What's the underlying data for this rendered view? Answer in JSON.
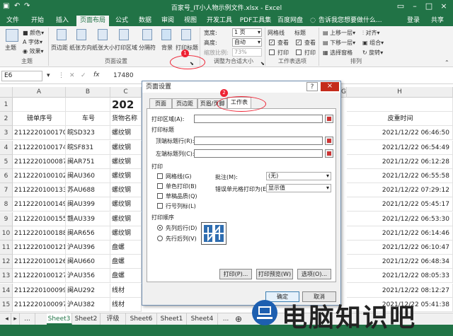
{
  "title": "百家号_IT小人物示例文件.xlsx - Excel",
  "tabs": [
    "文件",
    "开始",
    "插入",
    "页面布局",
    "公式",
    "数据",
    "审阅",
    "视图",
    "开发工具",
    "PDF工具集",
    "百度网盘"
  ],
  "active_tab": "页面布局",
  "tell_me": "告诉我您想要做什么...",
  "login": "登录",
  "share": "共享",
  "ribbon": {
    "theme": {
      "label": "主题",
      "colors": "颜色",
      "fonts": "字体",
      "effects": "效果",
      "group": "主题"
    },
    "margins": "页边距",
    "orientation": "纸张方向",
    "size": "纸张大小",
    "print_area": "打印区域",
    "breaks": "分隔符",
    "background": "背景",
    "print_titles": "打印标题",
    "page_setup_group": "页面设置",
    "width_label": "宽度:",
    "width_value": "1 页",
    "height_label": "高度:",
    "height_value": "自动",
    "scale_label": "缩放比例:",
    "scale_value": "73%",
    "scale_group": "调整为合适大小",
    "gridlines": "网格线",
    "headings": "标题",
    "view1": "查看",
    "print1": "打印",
    "view2": "查看",
    "print2": "打印",
    "sheet_options_group": "工作表选项",
    "bring_forward": "上移一层",
    "send_backward": "下移一层",
    "selection_pane": "选择窗格",
    "align": "对齐",
    "group_btn": "组合",
    "rotate": "旋转",
    "arrange_group": "排列"
  },
  "formula": {
    "namebox": "E6",
    "value": "17480"
  },
  "columns": [
    "A",
    "B",
    "C",
    "D",
    "E",
    "F",
    "G",
    "H"
  ],
  "rows": [
    {
      "n": "1",
      "a": "",
      "b": "",
      "c": "202"
    },
    {
      "n": "2",
      "a": "磅单序号",
      "b": "车号",
      "c": "货物名称",
      "h": "皮重时间"
    },
    {
      "n": "3",
      "a": "2112220100170",
      "b": "皖SD323",
      "c": "螺纹钢",
      "h": "2021/12/22 06:46:50"
    },
    {
      "n": "4",
      "a": "2112220100174",
      "b": "皖SF831",
      "c": "螺纹钢",
      "h": "2021/12/22 06:54:49"
    },
    {
      "n": "5",
      "a": "2112220100087",
      "b": "闽AR751",
      "c": "螺纹钢",
      "h": "2021/12/22 06:12:28"
    },
    {
      "n": "6",
      "a": "2112220100102",
      "b": "闽AU360",
      "c": "螺纹钢",
      "h": "2021/12/22 06:55:58"
    },
    {
      "n": "7",
      "a": "2112220100133",
      "b": "苏AU688",
      "c": "螺纹钢",
      "h": "2021/12/22 07:29:12"
    },
    {
      "n": "8",
      "a": "2112220100149",
      "b": "闽AU399",
      "c": "螺纹钢",
      "h": "2021/12/22 05:45:17"
    },
    {
      "n": "9",
      "a": "2112220100155",
      "b": "赣AU339",
      "c": "螺纹钢",
      "h": "2021/12/22 06:53:30"
    },
    {
      "n": "10",
      "a": "2112220100188",
      "b": "闽AR656",
      "c": "螺纹钢",
      "h": "2021/12/22 06:14:46"
    },
    {
      "n": "11",
      "a": "2112220100121",
      "b": "沪AU396",
      "c": "盘螺",
      "h": "2021/12/22 06:10:47"
    },
    {
      "n": "12",
      "a": "2112220100126",
      "b": "闽AU660",
      "c": "盘螺",
      "h": "2021/12/22 06:48:34"
    },
    {
      "n": "13",
      "a": "2112220100127",
      "b": "沪AU356",
      "c": "盘螺",
      "h": "2021/12/22 08:05:33"
    },
    {
      "n": "14",
      "a": "2112220100099",
      "b": "闽AU292",
      "c": "线材",
      "h": "2021/12/22 08:12:27"
    },
    {
      "n": "15",
      "a": "2112220100097",
      "b": "沪AU382",
      "c": "线材",
      "h": "2021/12/22 05:41:38"
    }
  ],
  "sheet_tabs": [
    "Sheet3",
    "Sheet2",
    "评级",
    "Sheet6",
    "Sheet1",
    "Sheet4"
  ],
  "active_sheet": "Sheet3",
  "dialog": {
    "title": "页面设置",
    "help": "?",
    "close": "×",
    "tabs": [
      "页面",
      "页边距",
      "页眉/页脚",
      "工作表"
    ],
    "active_tab": "工作表",
    "print_area_label": "打印区域(A):",
    "print_titles_label": "打印标题",
    "top_rows_label": "顶端标题行(R):",
    "left_cols_label": "左端标题列(C):",
    "print_label": "打印",
    "gridlines": "网格线(G)",
    "bw": "单色打印(B)",
    "draft": "草稿品质(Q)",
    "rowcol": "行号列标(L)",
    "comments_label": "批注(M):",
    "comments_value": "(无)",
    "errors_label": "错误单元格打印为(E):",
    "errors_value": "显示值",
    "order_label": "打印顺序",
    "down_then_over": "先列后行(D)",
    "over_then_down": "先行后列(V)",
    "print_btn": "打印(P)...",
    "preview_btn": "打印预览(W)",
    "options_btn": "选项(O)...",
    "ok": "确定",
    "cancel": "取消"
  },
  "badges": [
    "1",
    "2"
  ],
  "watermark": "电脑知识吧"
}
